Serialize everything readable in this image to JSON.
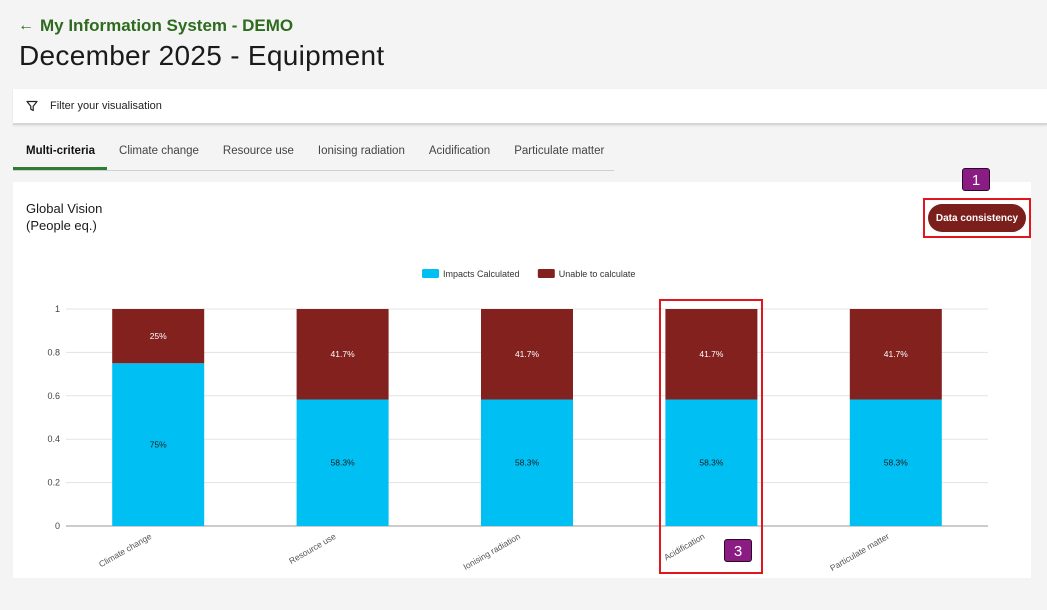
{
  "header": {
    "back_label": "My Information System - DEMO",
    "page_title": "December 2025 - Equipment"
  },
  "filter": {
    "label": "Filter your visualisation",
    "icon": "filter-icon"
  },
  "tabs": [
    {
      "label": "Multi-criteria",
      "active": true
    },
    {
      "label": "Climate change",
      "active": false
    },
    {
      "label": "Resource use",
      "active": false
    },
    {
      "label": "Ionising radiation",
      "active": false
    },
    {
      "label": "Acidification",
      "active": false
    },
    {
      "label": "Particulate matter",
      "active": false
    }
  ],
  "card": {
    "title_line1": "Global Vision",
    "title_line2": "(People eq.)",
    "data_consistency_label": "Data consistency"
  },
  "annotations": [
    {
      "label": "1",
      "target": "data-consistency-button"
    },
    {
      "label": "3",
      "target": "acidification-bar"
    }
  ],
  "colors": {
    "impacts": "#00bff3",
    "unable": "#82211e",
    "accent_green": "#2e7d32",
    "button": "#7b1f1d",
    "annotation": "#8b1c84"
  },
  "chart_data": {
    "type": "bar",
    "stacked": true,
    "categories": [
      "Climate change",
      "Resource use",
      "Ionising radiation",
      "Acidification",
      "Particulate matter"
    ],
    "series": [
      {
        "name": "Impacts Calculated",
        "values": [
          0.75,
          0.583,
          0.583,
          0.583,
          0.583
        ],
        "labels": [
          "75%",
          "58.3%",
          "58.3%",
          "58.3%",
          "58.3%"
        ],
        "color": "#00bff3"
      },
      {
        "name": "Unable to calculate",
        "values": [
          0.25,
          0.417,
          0.417,
          0.417,
          0.417
        ],
        "labels": [
          "25%",
          "41.7%",
          "41.7%",
          "41.7%",
          "41.7%"
        ],
        "color": "#82211e"
      }
    ],
    "yticks": [
      "0",
      "0.2",
      "0.4",
      "0.6",
      "0.8",
      "1"
    ],
    "ylim": [
      0,
      1
    ],
    "grid": true,
    "legend_position": "top-center"
  }
}
